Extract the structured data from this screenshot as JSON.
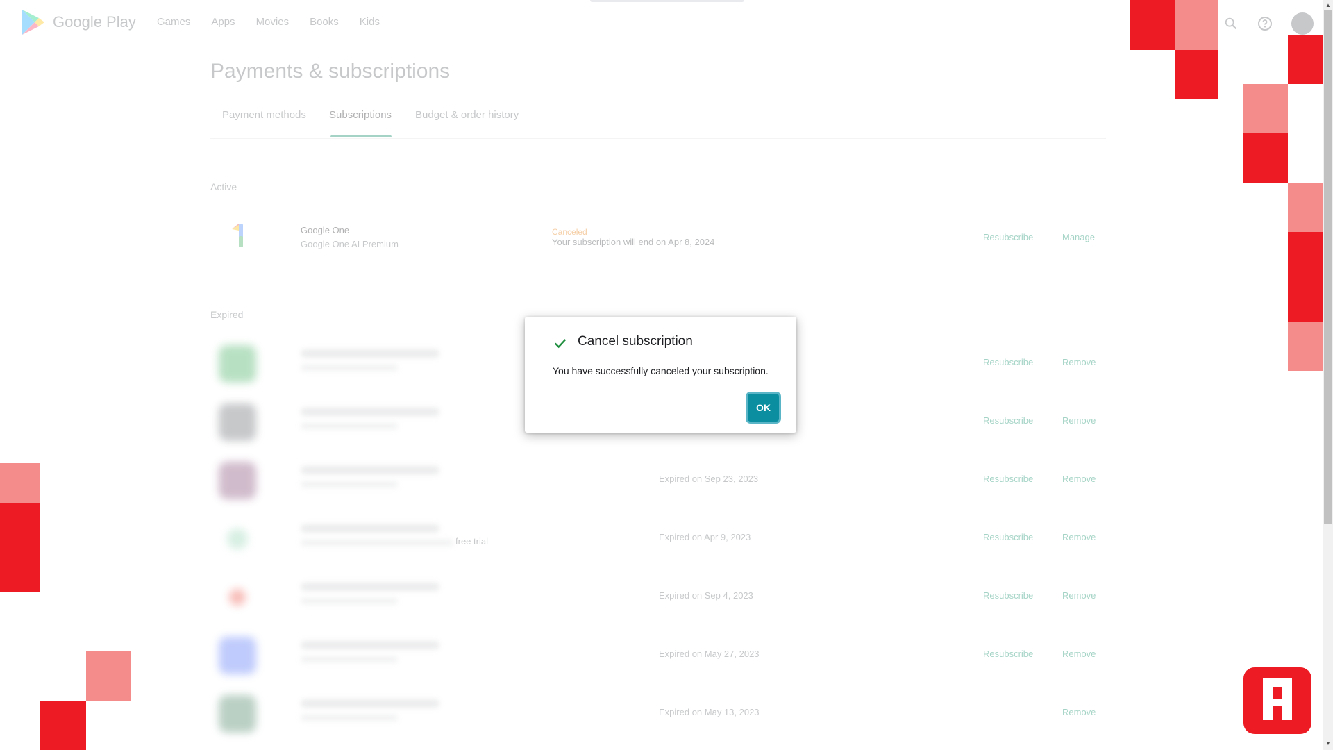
{
  "header": {
    "brand": "Google Play",
    "nav": [
      "Games",
      "Apps",
      "Movies",
      "Books",
      "Kids"
    ]
  },
  "page": {
    "title": "Payments & subscriptions",
    "tabs": [
      "Payment methods",
      "Subscriptions",
      "Budget & order history"
    ],
    "active_tab": "Subscriptions"
  },
  "active_section": {
    "label": "Active",
    "item": {
      "name": "Google One",
      "plan": "Google One AI Premium",
      "status": "Canceled",
      "detail": "Your subscription will end on Apr 8, 2024",
      "resubscribe": "Resubscribe",
      "manage": "Manage"
    }
  },
  "expired_section": {
    "label": "Expired",
    "items": [
      {
        "status": "",
        "resubscribe": "Resubscribe",
        "remove": "Remove",
        "icon_color": "#34a853"
      },
      {
        "status": "",
        "resubscribe": "Resubscribe",
        "remove": "Remove",
        "icon_color": "#5f6368"
      },
      {
        "status": "Expired on Sep 23, 2023",
        "resubscribe": "Resubscribe",
        "remove": "Remove",
        "icon_color": "#7b3f6e"
      },
      {
        "status": "Expired on Apr 9, 2023",
        "extra": "free trial",
        "resubscribe": "Resubscribe",
        "remove": "Remove",
        "icon_color": "#8ed1b0"
      },
      {
        "status": "Expired on Sep 4, 2023",
        "resubscribe": "Resubscribe",
        "remove": "Remove",
        "icon_color": "#ea4335"
      },
      {
        "status": "Expired on May 27, 2023",
        "resubscribe": "Resubscribe",
        "remove": "Remove",
        "icon_color": "#4a6cf7"
      },
      {
        "status": "Expired on May 13, 2023",
        "resubscribe": "",
        "remove": "Remove",
        "icon_color": "#3d7a5a"
      }
    ]
  },
  "dialog": {
    "title": "Cancel subscription",
    "message": "You have successfully canceled your subscription.",
    "ok": "OK"
  },
  "colors": {
    "accent_green": "#01875f",
    "ok_button": "#0a8ea0",
    "decor_red": "#ed1c24",
    "decor_pink": "#f48c8c"
  },
  "icons": [
    "google-play-logo",
    "search-icon",
    "help-icon",
    "avatar",
    "check-icon",
    "google-one-icon"
  ]
}
